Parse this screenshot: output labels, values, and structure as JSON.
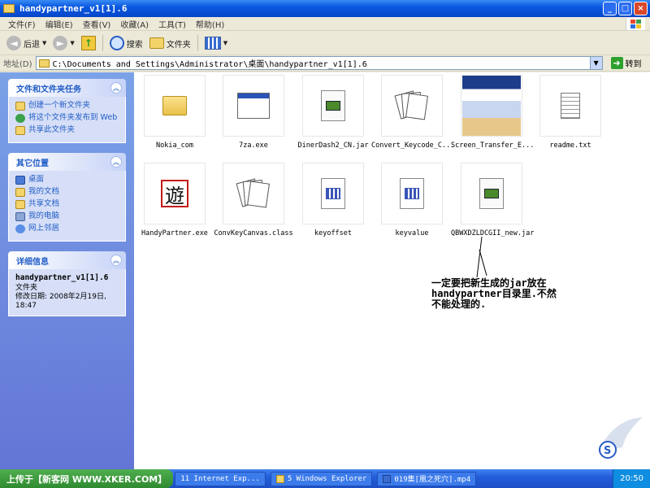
{
  "window": {
    "title": "handypartner_v1[1].6",
    "buttons": {
      "minimize": "_",
      "maximize": "□",
      "close": "×"
    }
  },
  "menu": [
    "文件(F)",
    "编辑(E)",
    "查看(V)",
    "收藏(A)",
    "工具(T)",
    "帮助(H)"
  ],
  "toolbar": {
    "back": "后退",
    "search": "搜索",
    "folders": "文件夹"
  },
  "address": {
    "label": "地址(D)",
    "path": "C:\\Documents and Settings\\Administrator\\桌面\\handypartner_v1[1].6",
    "go": "转到"
  },
  "tasks": {
    "file_tasks": {
      "title": "文件和文件夹任务",
      "items": [
        {
          "label": "创建一个新文件夹",
          "icon": "new-folder-icon"
        },
        {
          "label": "将这个文件夹发布到 Web",
          "icon": "publish-web-icon"
        },
        {
          "label": "共享此文件夹",
          "icon": "share-folder-icon"
        }
      ]
    },
    "other_places": {
      "title": "其它位置",
      "items": [
        {
          "label": "桌面",
          "icon": "desktop-icon"
        },
        {
          "label": "我的文档",
          "icon": "my-documents-icon"
        },
        {
          "label": "共享文档",
          "icon": "shared-documents-icon"
        },
        {
          "label": "我的电脑",
          "icon": "my-computer-icon"
        },
        {
          "label": "网上邻居",
          "icon": "network-places-icon"
        }
      ]
    },
    "details": {
      "title": "详细信息",
      "name": "handypartner_v1[1].6",
      "type": "文件夹",
      "modified": "修改日期: 2008年2月19日, 18:47"
    }
  },
  "files": [
    {
      "name": "Nokia_com",
      "icon": "folder-icon"
    },
    {
      "name": "7za.exe",
      "icon": "exe-window-icon"
    },
    {
      "name": "DinerDash2_CN.jar",
      "icon": "jar-file-icon"
    },
    {
      "name": "Convert_Keycode_C...",
      "icon": "class-file-icon"
    },
    {
      "name": "Screen_Transfer_E...",
      "icon": "screenshot-thumbnail-icon"
    },
    {
      "name": "readme.txt",
      "icon": "text-file-icon"
    },
    {
      "name": "HandyPartner.exe",
      "icon": "handypartner-app-icon"
    },
    {
      "name": "ConvKeyCanvas.class",
      "icon": "class-file-icon"
    },
    {
      "name": "keyoffset",
      "icon": "generic-file-icon"
    },
    {
      "name": "keyvalue",
      "icon": "generic-file-icon"
    },
    {
      "name": "QBWXDZLDCGII_new.jar",
      "icon": "jar-file-icon"
    }
  ],
  "annotation": "一定要把新生成的jar放在handypartner目录里.不然不能处理的.",
  "taskbar": {
    "start": "上传于【新客网 WWW.XKER.COM】",
    "buttons": [
      "11 Internet Exp...",
      "5 Windows Explorer",
      "019集[凰之死穴].mp4"
    ],
    "clock": "20:50"
  },
  "colors": {
    "titlebar": "#0a58e0",
    "taskpane": "#7ba2e7",
    "link": "#215dc6",
    "annotation_line": "#000000"
  }
}
